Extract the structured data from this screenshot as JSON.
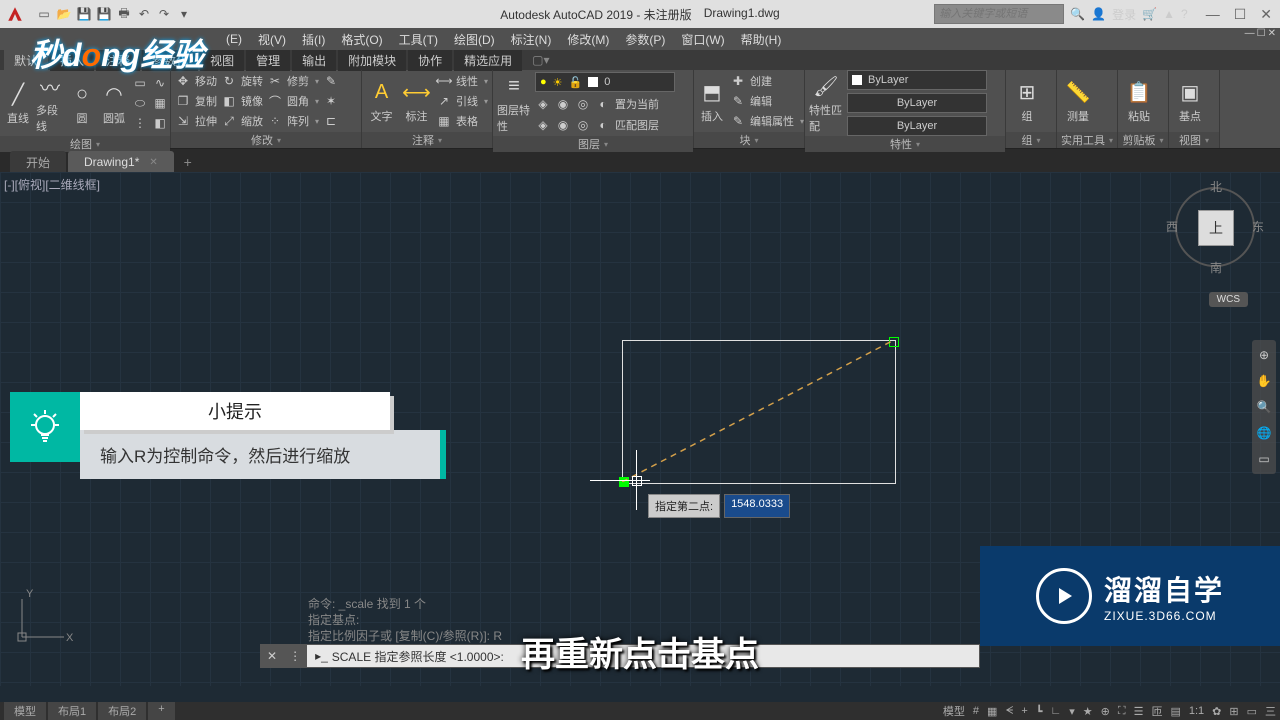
{
  "title": {
    "app": "Autodesk AutoCAD 2019 - 未注册版",
    "doc": "Drawing1.dwg"
  },
  "search_placeholder": "输入关键字或短语",
  "signin": "登录",
  "menus": [
    "(E)",
    "视(V)",
    "插(I)",
    "格式(O)",
    "工具(T)",
    "绘图(D)",
    "标注(N)",
    "修改(M)",
    "参数(P)",
    "窗口(W)",
    "帮助(H)"
  ],
  "ribbon_tabs": [
    "默认",
    "插入",
    "注释",
    "参数化",
    "视图",
    "管理",
    "输出",
    "附加模块",
    "协作",
    "精选应用"
  ],
  "panels": {
    "draw": {
      "label": "绘图",
      "line": "直线",
      "pline": "多段线",
      "circle": "圆",
      "arc": "圆弧"
    },
    "modify": {
      "label": "修改",
      "move": "移动",
      "rotate": "旋转",
      "trim": "修剪",
      "copy": "复制",
      "mirror": "镜像",
      "fillet": "圆角",
      "stretch": "拉伸",
      "scale": "缩放",
      "array": "阵列"
    },
    "annot": {
      "label": "注释",
      "text": "文字",
      "dim": "标注",
      "table": "表格",
      "linear": "线性",
      "leader": "引线"
    },
    "layer": {
      "label": "图层",
      "props": "图层特性",
      "current": "0",
      "setcur": "置为当前",
      "match": "匹配图层"
    },
    "block": {
      "label": "块",
      "insert": "插入",
      "create": "创建",
      "edit": "编辑",
      "editattr": "编辑属性"
    },
    "prop": {
      "label": "特性",
      "match": "特性匹配",
      "bylayer": "ByLayer"
    },
    "group": {
      "label": "组",
      "g": "组"
    },
    "util": {
      "label": "实用工具",
      "meas": "测量"
    },
    "clip": {
      "label": "剪贴板",
      "paste": "粘贴"
    },
    "view": {
      "label": "视图",
      "base": "基点"
    }
  },
  "doc_tabs": {
    "start": "开始",
    "active": "Drawing1*"
  },
  "viewport_label": "[-][俯视][二维线框]",
  "viewcube": {
    "top": "上",
    "n": "北",
    "s": "南",
    "e": "东",
    "w": "西",
    "wcs": "WCS"
  },
  "dyn": {
    "label": "指定第二点:",
    "value": "1548.0333"
  },
  "tip": {
    "title": "小提示",
    "body": "输入R为控制命令，然后进行缩放"
  },
  "cmd_history": [
    "命令: _scale 找到 1 个",
    "指定基点:",
    "指定比例因子或 [复制(C)/参照(R)]: R"
  ],
  "cmd_prompt": "SCALE 指定参照长度 <1.0000>:",
  "subtitle": "再重新点击基点",
  "status_tabs": [
    "模型",
    "布局1",
    "布局2"
  ],
  "status_right": [
    "模型",
    "#",
    "▦",
    "ᗕ",
    "+",
    "┗",
    "∟",
    "▾",
    "★",
    "⊕",
    "⛶",
    "☰",
    "匝",
    "▤",
    "1:1",
    "✿",
    "⊞",
    "▭",
    "三"
  ],
  "zixue": {
    "name": "溜溜自学",
    "url": "ZIXUE.3D66.COM"
  },
  "watermark": {
    "a": "秒d",
    "b": "o",
    "c": "ng经验"
  }
}
